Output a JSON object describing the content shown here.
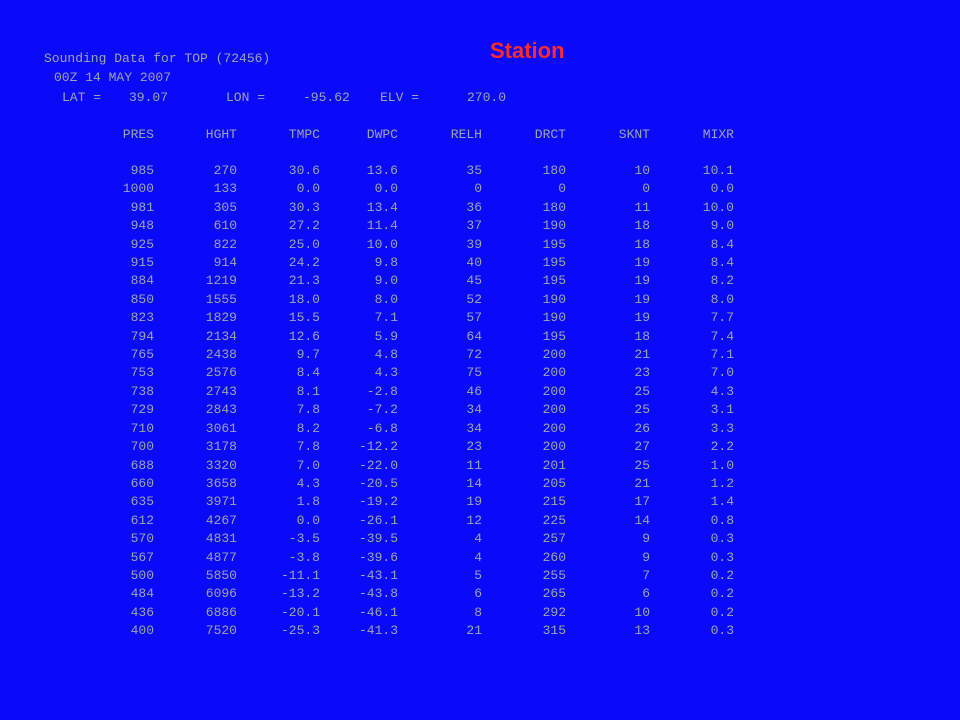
{
  "station_label": "Station",
  "header": {
    "line1": "Sounding Data for TOP (72456)",
    "line2": "00Z 14 MAY 2007",
    "lat_label": "LAT =",
    "lat_value": "39.07",
    "lon_label": "LON =",
    "lon_value": "-95.62",
    "elv_label": "ELV =",
    "elv_value": "270.0"
  },
  "table": {
    "columns": [
      "PRES",
      "HGHT",
      "TMPC",
      "DWPC",
      "RELH",
      "DRCT",
      "SKNT",
      "MIXR"
    ],
    "rows": [
      [
        "985",
        "270",
        "30.6",
        "13.6",
        "35",
        "180",
        "10",
        "10.1"
      ],
      [
        "1000",
        "133",
        "0.0",
        "0.0",
        "0",
        "0",
        "0",
        "0.0"
      ],
      [
        "981",
        "305",
        "30.3",
        "13.4",
        "36",
        "180",
        "11",
        "10.0"
      ],
      [
        "948",
        "610",
        "27.2",
        "11.4",
        "37",
        "190",
        "18",
        "9.0"
      ],
      [
        "925",
        "822",
        "25.0",
        "10.0",
        "39",
        "195",
        "18",
        "8.4"
      ],
      [
        "915",
        "914",
        "24.2",
        "9.8",
        "40",
        "195",
        "19",
        "8.4"
      ],
      [
        "884",
        "1219",
        "21.3",
        "9.0",
        "45",
        "195",
        "19",
        "8.2"
      ],
      [
        "850",
        "1555",
        "18.0",
        "8.0",
        "52",
        "190",
        "19",
        "8.0"
      ],
      [
        "823",
        "1829",
        "15.5",
        "7.1",
        "57",
        "190",
        "19",
        "7.7"
      ],
      [
        "794",
        "2134",
        "12.6",
        "5.9",
        "64",
        "195",
        "18",
        "7.4"
      ],
      [
        "765",
        "2438",
        "9.7",
        "4.8",
        "72",
        "200",
        "21",
        "7.1"
      ],
      [
        "753",
        "2576",
        "8.4",
        "4.3",
        "75",
        "200",
        "23",
        "7.0"
      ],
      [
        "738",
        "2743",
        "8.1",
        "-2.8",
        "46",
        "200",
        "25",
        "4.3"
      ],
      [
        "729",
        "2843",
        "7.8",
        "-7.2",
        "34",
        "200",
        "25",
        "3.1"
      ],
      [
        "710",
        "3061",
        "8.2",
        "-6.8",
        "34",
        "200",
        "26",
        "3.3"
      ],
      [
        "700",
        "3178",
        "7.8",
        "-12.2",
        "23",
        "200",
        "27",
        "2.2"
      ],
      [
        "688",
        "3320",
        "7.0",
        "-22.0",
        "11",
        "201",
        "25",
        "1.0"
      ],
      [
        "660",
        "3658",
        "4.3",
        "-20.5",
        "14",
        "205",
        "21",
        "1.2"
      ],
      [
        "635",
        "3971",
        "1.8",
        "-19.2",
        "19",
        "215",
        "17",
        "1.4"
      ],
      [
        "612",
        "4267",
        "0.0",
        "-26.1",
        "12",
        "225",
        "14",
        "0.8"
      ],
      [
        "570",
        "4831",
        "-3.5",
        "-39.5",
        "4",
        "257",
        "9",
        "0.3"
      ],
      [
        "567",
        "4877",
        "-3.8",
        "-39.6",
        "4",
        "260",
        "9",
        "0.3"
      ],
      [
        "500",
        "5850",
        "-11.1",
        "-43.1",
        "5",
        "255",
        "7",
        "0.2"
      ],
      [
        "484",
        "6096",
        "-13.2",
        "-43.8",
        "6",
        "265",
        "6",
        "0.2"
      ],
      [
        "436",
        "6886",
        "-20.1",
        "-46.1",
        "8",
        "292",
        "10",
        "0.2"
      ],
      [
        "400",
        "7520",
        "-25.3",
        "-41.3",
        "21",
        "315",
        "13",
        "0.3"
      ]
    ]
  }
}
